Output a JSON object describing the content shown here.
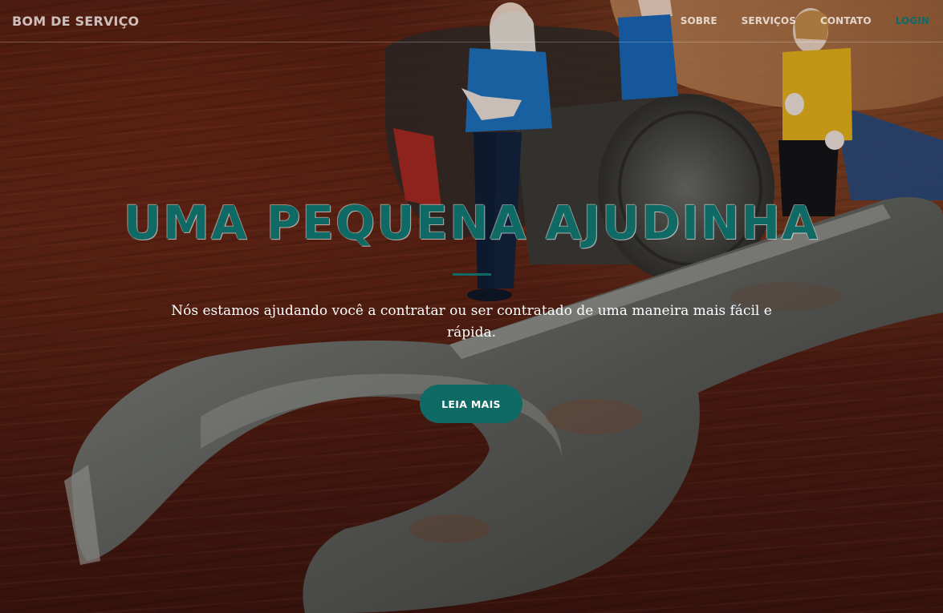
{
  "navbar": {
    "brand": "BOM DE SERVIÇO",
    "links": [
      {
        "label": "SOBRE"
      },
      {
        "label": "SERVIÇOS"
      },
      {
        "label": "CONTATO"
      },
      {
        "label": "LOGIN"
      }
    ]
  },
  "hero": {
    "title": "UMA PEQUENA AJUDINHA",
    "subtitle": "Nós estamos ajudando você a contratar ou ser contratado de uma maneira mais fácil e rápida.",
    "cta_label": "LEIA MAIS"
  },
  "colors": {
    "accent": "#0f6964",
    "text_light": "#ffffff"
  }
}
